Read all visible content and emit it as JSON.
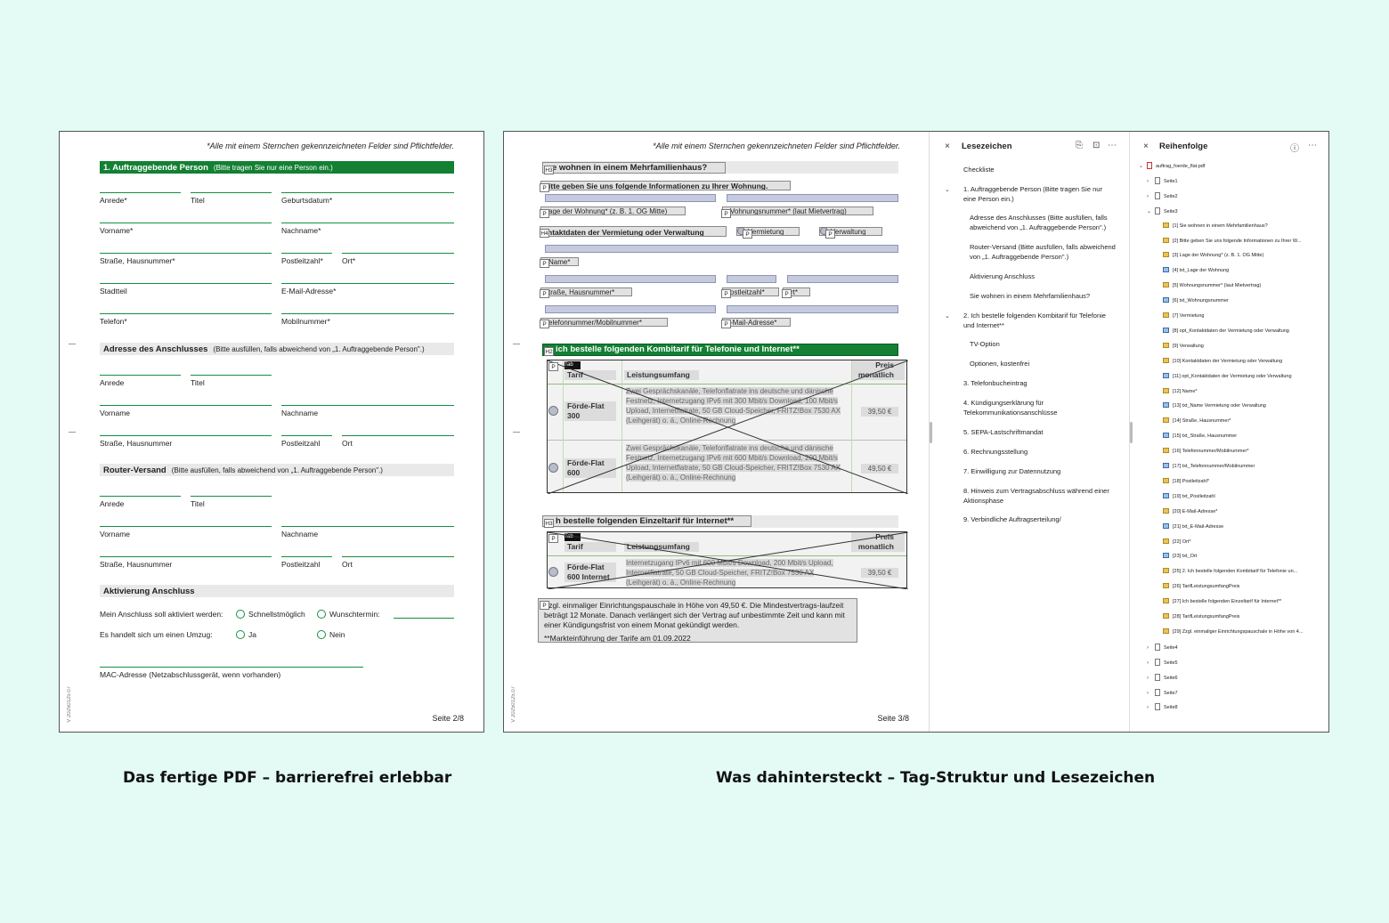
{
  "left": {
    "required_note": "*Alle mit einem Sternchen gekennzeichneten Felder sind Pflichtfelder.",
    "sec1": {
      "title": "1. Auftraggebende Person",
      "sub": "(Bitte tragen Sie nur eine Person ein.)"
    },
    "sec1_fields": [
      [
        "Anrede*",
        "Titel",
        "Geburtsdatum*"
      ],
      [
        "Vorname*",
        "Nachname*"
      ],
      [
        "Straße, Hausnummer*",
        "Postleitzahl*",
        "Ort*"
      ],
      [
        "Stadtteil",
        "E-Mail-Adresse*"
      ],
      [
        "Telefon*",
        "Mobilnummer*"
      ]
    ],
    "sec2": {
      "title": "Adresse des Anschlusses",
      "sub": "(Bitte ausfüllen, falls abweichend von „1. Auftraggebende Person\".)"
    },
    "sec2_fields": [
      [
        "Anrede",
        "Titel"
      ],
      [
        "Vorname",
        "Nachname"
      ],
      [
        "Straße, Hausnummer",
        "Postleitzahl",
        "Ort"
      ]
    ],
    "sec3": {
      "title": "Router-Versand",
      "sub": "(Bitte ausfüllen, falls abweichend von „1. Auftraggebende Person\".)"
    },
    "sec3_fields": [
      [
        "Anrede",
        "Titel"
      ],
      [
        "Vorname",
        "Nachname"
      ],
      [
        "Straße, Hausnummer",
        "Postleitzahl",
        "Ort"
      ]
    ],
    "sec4": {
      "title": "Aktivierung Anschluss"
    },
    "activation": {
      "label": "Mein Anschluss soll aktiviert werden:",
      "opt1": "Schnellstmöglich",
      "opt2": "Wunschtermin:",
      "move_label": "Es handelt sich um einen Umzug:",
      "yes": "Ja",
      "no": "Nein"
    },
    "mac_label": "MAC-Adresse (Netzabschlussgerät, wenn vorhanden)",
    "version": "V 20250125.07",
    "page": "Seite 2/8"
  },
  "tagged": {
    "required_note": "*Alle mit einem Sternchen gekennzeichneten Felder sind Pflichtfelder.",
    "h3_multi": "e wohnen in einem Mehrfamilienhaus?",
    "p_info": "itte geben Sie uns folgende Informationen zu Ihrer Wohnung.",
    "lage": "age der Wohnung* (z. B. 1. OG Mitte)",
    "wohnungsnummer": "Vohnungsnummer* (laut Mietvertrag)",
    "h4_contact": "ntaktdaten der Vermietung oder Verwaltung",
    "vermietung": "Vermietung",
    "verwaltung": "Verwaltung",
    "name": "Name*",
    "strasse": "traße, Hausnummer*",
    "plz": "ostleitzahl*",
    "ort": "rt*",
    "telefon": "elefonnummer/Mobilnummer*",
    "email": "-Mail-Adresse*",
    "h2_kombi": "ich bestelle folgenden Kombitarif für Telefonie und Internet**",
    "tab1": {
      "caption": "Tab",
      "col_tarif": "Tarif",
      "col_leistung": "Leistungsumfang",
      "col_preis": "Preis monatlich",
      "rows": [
        {
          "name": "Förde-Flat 300",
          "desc": "Zwei Gesprächskanäle, Telefonflatrate ins deutsche und dänische Festnetz, Internetzugang IPv6 mit 300 Mbit/s Download, 100 Mbit/s Upload, Internetflatrate, 50 GB Cloud-Speicher, FRITZ!Box 7530 AX (Leihgerät) o. ä., Online-Rechnung",
          "price": "39,50 €"
        },
        {
          "name": "Förde-Flat 600",
          "desc": "Zwei Gesprächskanäle, Telefonflatrate ins deutsche und dänische Festnetz, Internetzugang IPv6 mit 600 Mbit/s Download, 200 Mbit/s Upload, Internetflatrate, 50 GB Cloud-Speicher, FRITZ!Box 7530 AX (Leihgerät) o. ä., Online-Rechnung",
          "price": "49,50 €"
        }
      ]
    },
    "h3_einzel": "h bestelle folgenden Einzeltarif für Internet**",
    "tab2": {
      "caption": "Tab",
      "col_tarif": "Tarif",
      "col_leistung": "Leistungsumfang",
      "col_preis": "Preis monatlich",
      "rows": [
        {
          "name": "Förde-Flat 600 Internet",
          "desc": "Internetzugang IPv6 mit 600 Mbit/s Download, 200 Mbit/s Upload, Internetflatrate, 50 GB Cloud-Speicher, FRITZ!Box 7530 AX (Leihgerät) o. ä., Online-Rechnung",
          "price": "39,50 €"
        }
      ]
    },
    "footnote": "Zzgl. einmaliger Einrichtungspauschale in Höhe von 49,50 €. Die Mindestvertrags-laufzeit beträgt 12 Monate. Danach verlängert sich der Vertrag auf unbestimmte Zeit und kann mit einer Kündigungsfrist von einem Monat gekündigt werden.",
    "footnote2": "**Markteinführung der Tarife am 01.09.2022",
    "version": "V 20250125.07",
    "page": "Seite 3/8"
  },
  "bookmarks": {
    "title": "Lesezeichen",
    "items": [
      "Checkliste",
      "1. Auftraggebende Person (Bitte tragen Sie nur eine Person ein.)",
      "Adresse des Anschlusses (Bitte ausfüllen, falls abweichend von „1. Auftraggebende Person\".)",
      "Router-Versand (Bitte ausfüllen, falls abweichend von „1. Auftraggebende Person\".)",
      "Aktivierung Anschluss",
      "Sie wohnen in einem Mehrfamilienhaus?",
      "2. Ich bestelle folgenden Kombitarif für Telefonie und Internet**",
      "TV-Option",
      "Optionen, kostenfrei",
      "3. Telefonbucheintrag",
      "4. Kündigungserklärung für Telekommunikationsanschlüsse",
      "5. SEPA-Lastschriftmandat",
      "6. Rechnungsstellung",
      "7. Einwilligung zur Datennutzung",
      "8. Hinweis zum Vertragsabschluss während einer Aktionsphase",
      "9. Verbindliche Auftragserteilung/"
    ]
  },
  "order": {
    "title": "Reihenfolge",
    "file": "auftrag_foerde_flat.pdf",
    "pages_before": [
      "Seite1",
      "Seite2",
      "Seite3"
    ],
    "items": [
      {
        "t": "[1] Sie wohnen in einem Mehrfamilienhaus?",
        "k": "tag"
      },
      {
        "t": "[2] Bitte geben Sie uns folgende Informationen zu Ihrer W...",
        "k": "tag"
      },
      {
        "t": "[3] Lage der Wohnung* (z. B. 1. OG Mitte)",
        "k": "tag"
      },
      {
        "t": "[4] txt_Lage der Wohnung",
        "k": "field"
      },
      {
        "t": "[5] Wohnungsnummer* (laut Mietvertrag)",
        "k": "tag"
      },
      {
        "t": "[6] txt_Wohnungsnummer",
        "k": "field"
      },
      {
        "t": "[7] Vermietung",
        "k": "tag"
      },
      {
        "t": "[8] opt_Kontaktdaten der Vermietung oder Verwaltung",
        "k": "field"
      },
      {
        "t": "[9] Verwaltung",
        "k": "tag"
      },
      {
        "t": "[10] Kontaktdaten der Vermietung oder Verwaltung",
        "k": "tag"
      },
      {
        "t": "[11] opt_Kontaktdaten der Vermietung oder Verwaltung",
        "k": "field"
      },
      {
        "t": "[12] Name*",
        "k": "tag"
      },
      {
        "t": "[13] txt_Name Vermietung oder Verwaltung",
        "k": "field"
      },
      {
        "t": "[14] Straße, Hausnummer*",
        "k": "tag"
      },
      {
        "t": "[15] txt_Straße, Hausnummer",
        "k": "field"
      },
      {
        "t": "[16] Telefonnummer/Mobilnummer*",
        "k": "tag"
      },
      {
        "t": "[17] txt_Telefonnummer/Mobilnummer",
        "k": "field"
      },
      {
        "t": "[18] Postleitzahl*",
        "k": "tag"
      },
      {
        "t": "[19] txt_Postleitzahl",
        "k": "field"
      },
      {
        "t": "[20] E-Mail-Adresse*",
        "k": "tag"
      },
      {
        "t": "[21] txt_E-Mail-Adresse",
        "k": "field"
      },
      {
        "t": "[22] Ort*",
        "k": "tag"
      },
      {
        "t": "[23] txt_Ort",
        "k": "field"
      },
      {
        "t": "[25] 2. Ich bestelle folgenden Kombitarif für Telefonie un...",
        "k": "tag"
      },
      {
        "t": "[26] TarifLeistungsumfangPreis",
        "k": "tag"
      },
      {
        "t": "[27] Ich bestelle folgenden Einzeltarif für Internet**",
        "k": "tag"
      },
      {
        "t": "[28] TarifLeistungsumfangPreis",
        "k": "tag"
      },
      {
        "t": "[29] Zzgl. einmaliger Einrichtungspauschale in Höhe von 4...",
        "k": "tag"
      }
    ],
    "pages_after": [
      "Seite4",
      "Seite5",
      "Seite6",
      "Seite7",
      "Seite8"
    ]
  },
  "captions": {
    "left": "Das fertige PDF – barrierefrei erlebbar",
    "right": "Was dahintersteckt – Tag-Struktur und Lesezeichen"
  },
  "colors": {
    "brand_green": "#138033",
    "background": "#e3fbf4",
    "field_blue": "#c6cadf"
  }
}
